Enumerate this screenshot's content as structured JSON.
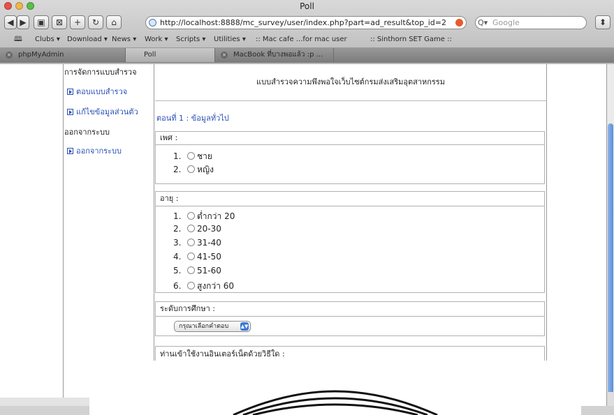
{
  "window": {
    "title": "Poll"
  },
  "toolbar": {
    "url": "http://localhost:8888/mc_survey/user/index.php?part=ad_result&top_id=2",
    "search_placeholder": "Google"
  },
  "bookmarks": [
    "Clubs ▾",
    "Download ▾",
    "News ▾",
    "Work ▾",
    "Scripts ▾",
    "Utilities ▾",
    ":: Mac cafe ...for mac user",
    ":: Sinthorn SET Game ::"
  ],
  "tabs": [
    {
      "label": "phpMyAdmin"
    },
    {
      "label": "Poll"
    },
    {
      "label": "MacBook ที่บางพอแล้ว :p ..."
    }
  ],
  "sidebar": {
    "heading_manage": "การจัดการแบบสำรวจ",
    "link_answer": "ตอบแบบสำรวจ",
    "link_edit": "แก้ไขข้อมูลส่วนตัว",
    "heading_logout": "ออกจากระบบ",
    "link_logout": "ออกจากระบบ"
  },
  "form": {
    "title": "แบบสำรวจความพึงพอใจเว็บไซต์กรมส่งเสริมอุตสาหกรรม",
    "section": "ตอนที่ 1 : ข้อมูลทั่วไป",
    "gender": {
      "label": "เพศ :",
      "options": [
        {
          "num": "1.",
          "text": "ชาย"
        },
        {
          "num": "2.",
          "text": "หญิง"
        }
      ]
    },
    "age": {
      "label": "อายุ :",
      "options": [
        {
          "num": "1.",
          "text": "ต่ำกว่า 20"
        },
        {
          "num": "2.",
          "text": "20-30"
        },
        {
          "num": "3.",
          "text": "31-40"
        },
        {
          "num": "4.",
          "text": "41-50"
        },
        {
          "num": "5.",
          "text": "51-60"
        },
        {
          "num": "6.",
          "text": "สูงกว่า 60"
        }
      ]
    },
    "education": {
      "label": "ระดับการศึกษา :",
      "select_value": "กรุณาเลือกคำตอบ"
    },
    "internet": {
      "label": "ท่านเข้าใช้งานอินเตอร์เน็ตด้วยวิธีใด :"
    }
  },
  "colors": {
    "link": "#2a4fb6",
    "scroll_thumb": "#5a8fd8"
  }
}
